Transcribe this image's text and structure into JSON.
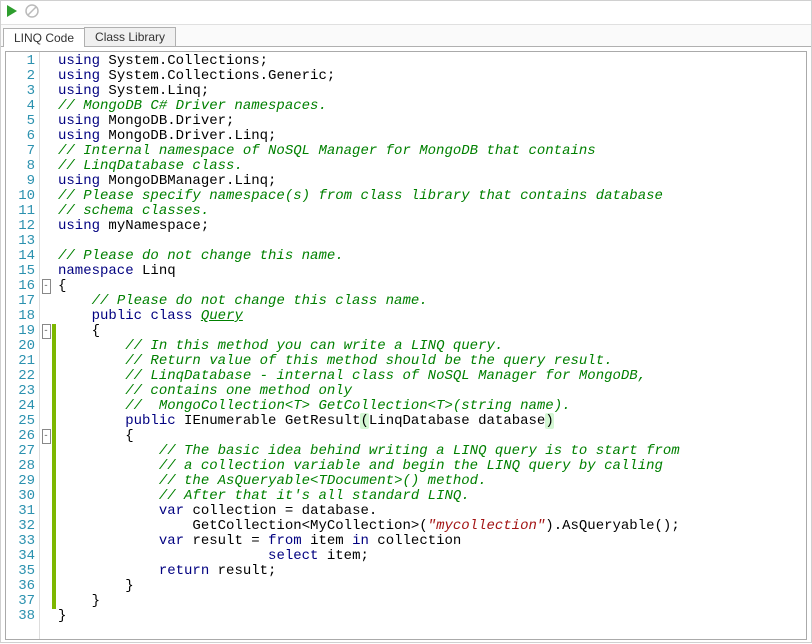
{
  "toolbar": {
    "run_icon": "run-icon",
    "stop_icon": "stop-icon"
  },
  "tabs": [
    {
      "label": "LINQ Code",
      "active": true
    },
    {
      "label": "Class Library",
      "active": false
    }
  ],
  "code_lines": [
    {
      "n": 1,
      "fold": "",
      "ch": "",
      "html": "<span class='kw'>using</span> System.Collections;"
    },
    {
      "n": 2,
      "fold": "",
      "ch": "",
      "html": "<span class='kw'>using</span> System.Collections.Generic;"
    },
    {
      "n": 3,
      "fold": "",
      "ch": "",
      "html": "<span class='kw'>using</span> System.Linq;"
    },
    {
      "n": 4,
      "fold": "",
      "ch": "",
      "html": "<span class='cm'>// MongoDB C# Driver namespaces.</span>"
    },
    {
      "n": 5,
      "fold": "",
      "ch": "",
      "html": "<span class='kw'>using</span> MongoDB.Driver;"
    },
    {
      "n": 6,
      "fold": "",
      "ch": "",
      "html": "<span class='kw'>using</span> MongoDB.Driver.Linq;"
    },
    {
      "n": 7,
      "fold": "",
      "ch": "",
      "html": "<span class='cm'>// Internal namespace of NoSQL Manager for MongoDB that contains</span>"
    },
    {
      "n": 8,
      "fold": "",
      "ch": "",
      "html": "<span class='cm'>// LinqDatabase class.</span>"
    },
    {
      "n": 9,
      "fold": "",
      "ch": "",
      "html": "<span class='kw'>using</span> MongoDBManager.Linq;"
    },
    {
      "n": 10,
      "fold": "",
      "ch": "",
      "html": "<span class='cm'>// Please specify namespace(s) from class library that contains database</span>"
    },
    {
      "n": 11,
      "fold": "",
      "ch": "",
      "html": "<span class='cm'>// schema classes.</span>"
    },
    {
      "n": 12,
      "fold": "",
      "ch": "",
      "html": "<span class='kw'>using</span> myNamespace;"
    },
    {
      "n": 13,
      "fold": "",
      "ch": "",
      "html": ""
    },
    {
      "n": 14,
      "fold": "",
      "ch": "",
      "html": "<span class='cm'>// Please do not change this name.</span>"
    },
    {
      "n": 15,
      "fold": "",
      "ch": "",
      "html": "<span class='kw'>namespace</span> Linq"
    },
    {
      "n": 16,
      "fold": "-",
      "ch": "",
      "html": "{"
    },
    {
      "n": 17,
      "fold": "",
      "ch": "",
      "html": "    <span class='cm'>// Please do not change this class name.</span>"
    },
    {
      "n": 18,
      "fold": "",
      "ch": "",
      "html": "    <span class='kw'>public</span> <span class='kw'>class</span> <span class='cm-link'>Query</span>"
    },
    {
      "n": 19,
      "fold": "-",
      "ch": "g",
      "html": "    { "
    },
    {
      "n": 20,
      "fold": "",
      "ch": "g",
      "html": "        <span class='cm'>// In this method you can write a LINQ query.</span>"
    },
    {
      "n": 21,
      "fold": "",
      "ch": "g",
      "html": "        <span class='cm'>// Return value of this method should be the query result.</span>"
    },
    {
      "n": 22,
      "fold": "",
      "ch": "g",
      "html": "        <span class='cm'>// LinqDatabase - internal class of NoSQL Manager for MongoDB,</span>"
    },
    {
      "n": 23,
      "fold": "",
      "ch": "g",
      "html": "        <span class='cm'>// contains one method only</span>"
    },
    {
      "n": 24,
      "fold": "",
      "ch": "g",
      "html": "        <span class='cm'>//  MongoCollection&lt;T&gt; GetCollection&lt;T&gt;(string name).</span>"
    },
    {
      "n": 25,
      "fold": "",
      "ch": "g",
      "html": "        <span class='kw'>public</span> IEnumerable GetResult<span class='hl'>(</span>LinqDatabase database<span class='hl'>)</span>"
    },
    {
      "n": 26,
      "fold": "-",
      "ch": "g",
      "html": "        {"
    },
    {
      "n": 27,
      "fold": "",
      "ch": "g",
      "html": "            <span class='cm'>// The basic idea behind writing a LINQ query is to start from</span>"
    },
    {
      "n": 28,
      "fold": "",
      "ch": "g",
      "html": "            <span class='cm'>// a collection variable and begin the LINQ query by calling</span>"
    },
    {
      "n": 29,
      "fold": "",
      "ch": "g",
      "html": "            <span class='cm'>// the AsQueryable&lt;TDocument&gt;() method.</span>"
    },
    {
      "n": 30,
      "fold": "",
      "ch": "g",
      "html": "            <span class='cm'>// After that it's all standard LINQ.</span>"
    },
    {
      "n": 31,
      "fold": "",
      "ch": "g",
      "html": "            <span class='kw'>var</span> collection = database."
    },
    {
      "n": 32,
      "fold": "",
      "ch": "g",
      "html": "                GetCollection&lt;MyCollection&gt;(<span class='str'>\"mycollection\"</span>).AsQueryable();"
    },
    {
      "n": 33,
      "fold": "",
      "ch": "g",
      "html": "            <span class='kw'>var</span> result = <span class='kw'>from</span> item <span class='kw'>in</span> collection"
    },
    {
      "n": 34,
      "fold": "",
      "ch": "g",
      "html": "                         <span class='kw'>select</span> item;"
    },
    {
      "n": 35,
      "fold": "",
      "ch": "g",
      "html": "            <span class='kw'>return</span> result;"
    },
    {
      "n": 36,
      "fold": "",
      "ch": "g",
      "html": "        }"
    },
    {
      "n": 37,
      "fold": "",
      "ch": "g",
      "html": "    }"
    },
    {
      "n": 38,
      "fold": "",
      "ch": "",
      "html": "}"
    }
  ]
}
